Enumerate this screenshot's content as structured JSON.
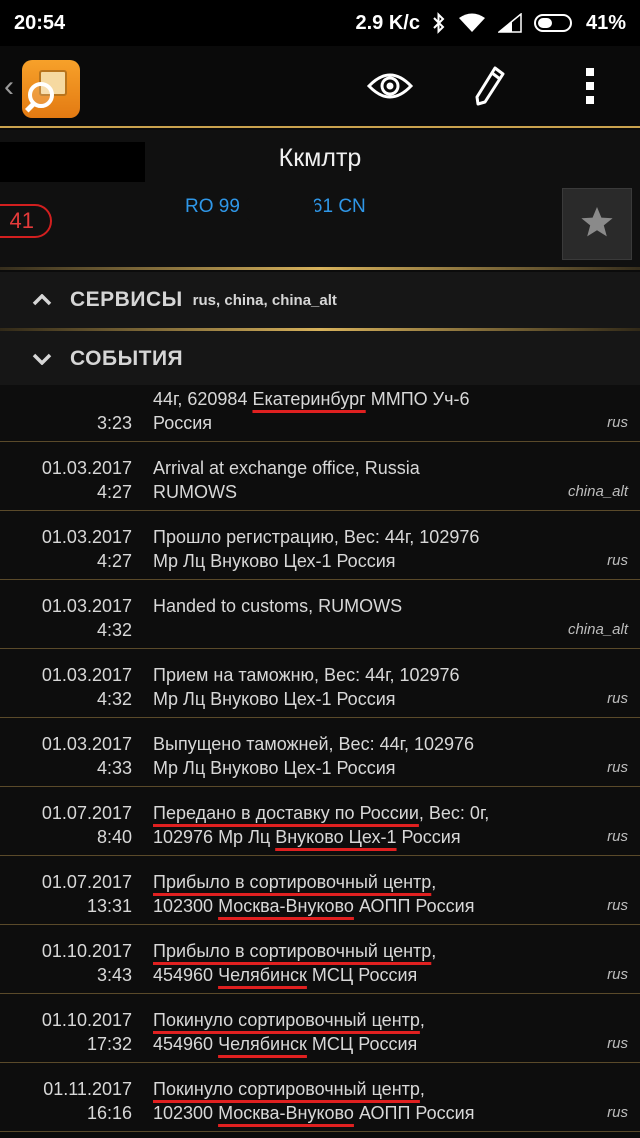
{
  "status_bar": {
    "time": "20:54",
    "speed": "2.9 K/c",
    "battery": "41%"
  },
  "header": {
    "title": "Ккмлтр",
    "count_badge": "41",
    "tracking_prefix": "RO 99",
    "tracking_suffix": "61 CN"
  },
  "sections": {
    "services": {
      "title": "СЕРВИСЫ",
      "sources": "rus, china, china_alt"
    },
    "events": {
      "title": "СОБЫТИЯ"
    }
  },
  "events": [
    {
      "date": "",
      "time": "3:23",
      "lines": [
        [
          {
            "t": "44г, 620984 "
          },
          {
            "t": "Екатеринбург",
            "u": true
          },
          {
            "t": " ММПО Уч-6"
          }
        ],
        [
          {
            "t": "Россия"
          }
        ]
      ],
      "source": "rus"
    },
    {
      "date": "01.03.2017",
      "time": "4:27",
      "lines": [
        [
          {
            "t": "Arrival at exchange office, Russia"
          }
        ],
        [
          {
            "t": "RUMOWS"
          }
        ]
      ],
      "source": "china_alt"
    },
    {
      "date": "01.03.2017",
      "time": "4:27",
      "lines": [
        [
          {
            "t": "Прошло регистрацию, Вес: 44г, 102976"
          }
        ],
        [
          {
            "t": "Мр Лц Внуково Цех-1 Россия"
          }
        ]
      ],
      "source": "rus"
    },
    {
      "date": "01.03.2017",
      "time": "4:32",
      "lines": [
        [
          {
            "t": "Handed to customs, RUMOWS"
          }
        ]
      ],
      "source": "china_alt"
    },
    {
      "date": "01.03.2017",
      "time": "4:32",
      "lines": [
        [
          {
            "t": "Прием на таможню, Вес: 44г, 102976"
          }
        ],
        [
          {
            "t": "Мр Лц Внуково Цех-1 Россия"
          }
        ]
      ],
      "source": "rus"
    },
    {
      "date": "01.03.2017",
      "time": "4:33",
      "lines": [
        [
          {
            "t": "Выпущено таможней, Вес: 44г, 102976"
          }
        ],
        [
          {
            "t": "Мр Лц Внуково Цех-1 Россия"
          }
        ]
      ],
      "source": "rus"
    },
    {
      "date": "01.07.2017",
      "time": "8:40",
      "lines": [
        [
          {
            "t": "Передано в доставку по России",
            "u": true
          },
          {
            "t": ", Вес: 0г,"
          }
        ],
        [
          {
            "t": "102976 Мр Лц "
          },
          {
            "t": "Внуково Цех-1",
            "u": true
          },
          {
            "t": " Россия"
          }
        ]
      ],
      "source": "rus"
    },
    {
      "date": "01.07.2017",
      "time": "13:31",
      "lines": [
        [
          {
            "t": "Прибыло в сортировочный центр",
            "u": true
          },
          {
            "t": ","
          }
        ],
        [
          {
            "t": "102300 "
          },
          {
            "t": "Москва-Внуково",
            "u": true
          },
          {
            "t": " АОПП Россия"
          }
        ]
      ],
      "source": "rus"
    },
    {
      "date": "01.10.2017",
      "time": "3:43",
      "lines": [
        [
          {
            "t": "Прибыло в сортировочный центр",
            "u": true
          },
          {
            "t": ","
          }
        ],
        [
          {
            "t": "454960 "
          },
          {
            "t": "Челябинск",
            "u": true
          },
          {
            "t": " МСЦ Россия"
          }
        ]
      ],
      "source": "rus"
    },
    {
      "date": "01.10.2017",
      "time": "17:32",
      "lines": [
        [
          {
            "t": "Покинуло сортировочный центр",
            "u": true
          },
          {
            "t": ","
          }
        ],
        [
          {
            "t": "454960 "
          },
          {
            "t": "Челябинск",
            "u": true
          },
          {
            "t": " МСЦ Россия"
          }
        ]
      ],
      "source": "rus"
    },
    {
      "date": "01.11.2017",
      "time": "16:16",
      "lines": [
        [
          {
            "t": "Покинуло сортировочный центр",
            "u": true
          },
          {
            "t": ","
          }
        ],
        [
          {
            "t": "102300 "
          },
          {
            "t": "Москва-Внуково",
            "u": true
          },
          {
            "t": " АОПП Россия"
          }
        ]
      ],
      "source": "rus"
    }
  ],
  "icons": {
    "back": "chevron-left-icon",
    "logo": "package-search-logo",
    "view": "eye-icon",
    "edit": "pencil-icon",
    "menu": "more-vertical-icon",
    "favorite": "star-icon"
  },
  "colors": {
    "accent": "#c9a24e",
    "link": "#2f97e8",
    "badge": "#d21f1f",
    "underline": "#e02020"
  }
}
